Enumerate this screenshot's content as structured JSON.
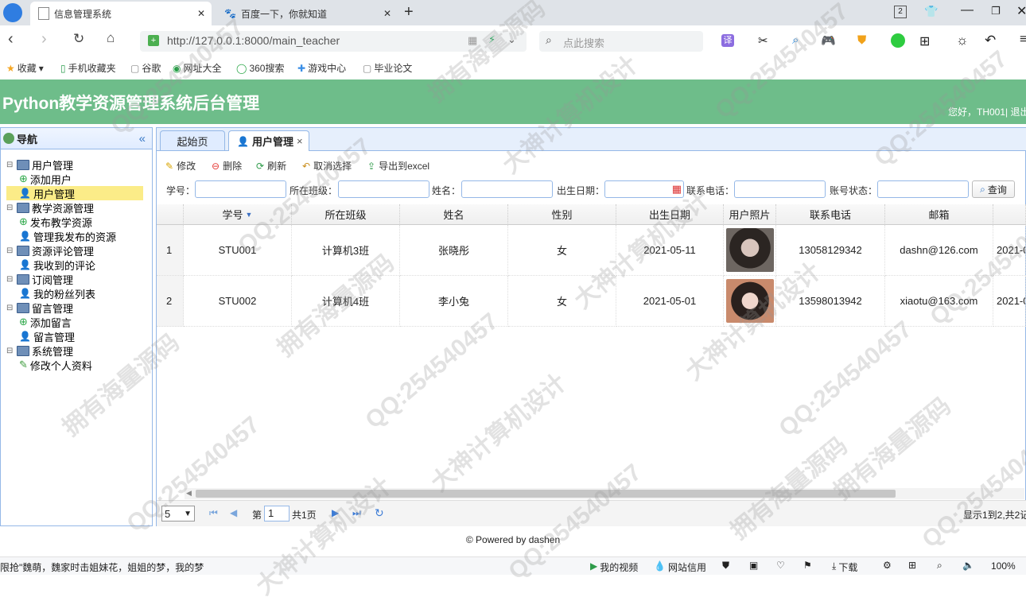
{
  "browser": {
    "tabs": [
      {
        "label": "信息管理系统",
        "active": true
      },
      {
        "label": "百度一下，你就知道",
        "active": false
      }
    ],
    "tab_count": "2",
    "address": "http://127.0.0.1:8000/main_teacher",
    "search_placeholder": "点此搜索",
    "bookmarks": [
      "收藏",
      "手机收藏夹",
      "谷歌",
      "网址大全",
      "360搜索",
      "游戏中心",
      "毕业论文"
    ]
  },
  "app": {
    "title": "Python教学资源管理系统后台管理",
    "greeting": "您好，TH001| 退出",
    "accent": "#6ebd8a"
  },
  "nav": {
    "title": "导航",
    "collapse": "«",
    "groups": [
      {
        "label": "用户管理",
        "items": [
          "添加用户",
          "用户管理"
        ]
      },
      {
        "label": "教学资源管理",
        "items": [
          "发布教学资源",
          "管理我发布的资源"
        ]
      },
      {
        "label": "资源评论管理",
        "items": [
          "我收到的评论"
        ]
      },
      {
        "label": "订阅管理",
        "items": [
          "我的粉丝列表"
        ]
      },
      {
        "label": "留言管理",
        "items": [
          "添加留言",
          "留言管理"
        ]
      },
      {
        "label": "系统管理",
        "items": [
          "修改个人资料"
        ]
      }
    ],
    "selected": "用户管理"
  },
  "panel_tabs": [
    {
      "label": "起始页"
    },
    {
      "label": "用户管理",
      "closable": "×"
    }
  ],
  "toolbar": {
    "edit": "修改",
    "delete": "删除",
    "refresh": "刷新",
    "cancel_select": "取消选择",
    "export": "导出到excel"
  },
  "filters": {
    "student_id": "学号：",
    "class": "所在班级：",
    "name": "姓名：",
    "birth": "出生日期：",
    "phone": "联系电话：",
    "status": "账号状态：",
    "query": "查询"
  },
  "table": {
    "headers": [
      "学号",
      "所在班级",
      "姓名",
      "性别",
      "出生日期",
      "用户照片",
      "联系电话",
      "邮箱",
      ""
    ],
    "rows": [
      {
        "num": "1",
        "id": "STU001",
        "class": "计算机3班",
        "name": "张晓彤",
        "gender": "女",
        "birth": "2021-05-11",
        "phone": "13058129342",
        "email": "dashn@126.com",
        "extra": "2021-0"
      },
      {
        "num": "2",
        "id": "STU002",
        "class": "计算机4班",
        "name": "李小兔",
        "gender": "女",
        "birth": "2021-05-01",
        "phone": "13598013942",
        "email": "xiaotu@163.com",
        "extra": "2021-0"
      }
    ]
  },
  "pager": {
    "size": "5",
    "page_prefix": "第",
    "page": "1",
    "page_suffix": "共1页",
    "summary": "显示1到2,共2记"
  },
  "footer": "© Powered by dashen",
  "statusbar": {
    "left": "限抢\"魏萌，魏家时击姐妹花，姐姐的梦，我的梦",
    "video": "我的视频",
    "credit": "网站信用",
    "download": "下载",
    "zoom": "100%"
  },
  "watermarks": [
    "QQ:254540457",
    "拥有海量源码",
    "大神计算机设计"
  ]
}
